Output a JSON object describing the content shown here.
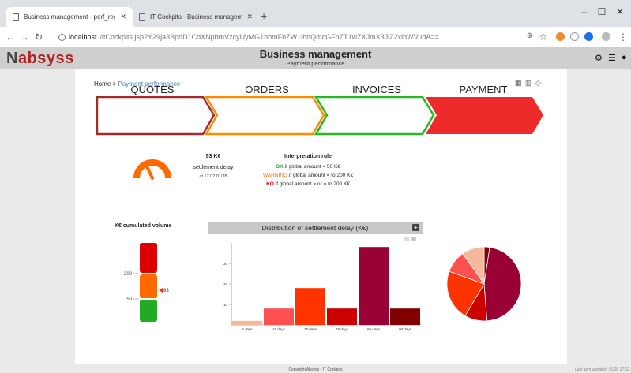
{
  "browser": {
    "tabs": [
      {
        "title": "Business management - perf_reg"
      },
      {
        "title": "IT Cockpits - Business management"
      }
    ],
    "url_host": "localhost",
    "url_path": "/itCockpits.jsp?Y29ja3BpdD1CdXNpbmVzcyUyMG1hbmFnZW1lbnQmcGFnZT1wZXJmX3JlZ2xlbWVudA=="
  },
  "app": {
    "logo_text": "absyss",
    "title": "Business management",
    "subtitle": "Payment performance"
  },
  "breadcrumb": {
    "home": "Home",
    "separator": ">",
    "current": "Payment performance"
  },
  "steps": [
    {
      "label": "QUOTES",
      "color": "#a52a2a"
    },
    {
      "label": "ORDERS",
      "color": "#ff8c00"
    },
    {
      "label": "INVOICES",
      "color": "#22bb22"
    },
    {
      "label": "PAYMENT",
      "color": "#ee2b2b"
    }
  ],
  "kpi": {
    "value": "93 K€",
    "label": "settlement delay",
    "date": "at 17.02 01/28",
    "gauge_color": "#ff6a00"
  },
  "rules": {
    "title": "Interpretation rule",
    "ok_label": "OK",
    "ok_text": " if global amount < 50 K€",
    "warn_label": "WARNING",
    "warn_text": " if global amount < to 200 K€",
    "ko_label": "KO",
    "ko_text": " if global amount > or = to 200 K€"
  },
  "volume": {
    "title": "K€ cumulated volume",
    "tick_200": "200",
    "tick_50": "50",
    "marker_value": "93",
    "value": 93
  },
  "chart_data": {
    "type": "bar",
    "title": "Distribution of settlement delay (K€)",
    "categories": [
      "5 days",
      "15 days",
      "30 days",
      "45 days",
      "60 days",
      "90 days"
    ],
    "values": [
      2,
      8,
      18,
      8,
      38,
      8
    ],
    "colors": [
      "#f5b89a",
      "#ff5050",
      "#ff3300",
      "#cc0000",
      "#990033",
      "#800000"
    ],
    "ylim": [
      0,
      40
    ],
    "yticks": [
      10,
      20,
      30
    ],
    "xlabel": "",
    "ylabel": ""
  },
  "pie_data": {
    "colors": [
      "#800000",
      "#990033",
      "#cc0000",
      "#ff3300",
      "#ff5050",
      "#f5b89a"
    ],
    "values": [
      2,
      38,
      8,
      18,
      8,
      8
    ]
  },
  "footer": {
    "copyright": "Copyright Absyss",
    "product": "IT Cockpits",
    "updated": "Last item updated: 01/28 17:02"
  }
}
